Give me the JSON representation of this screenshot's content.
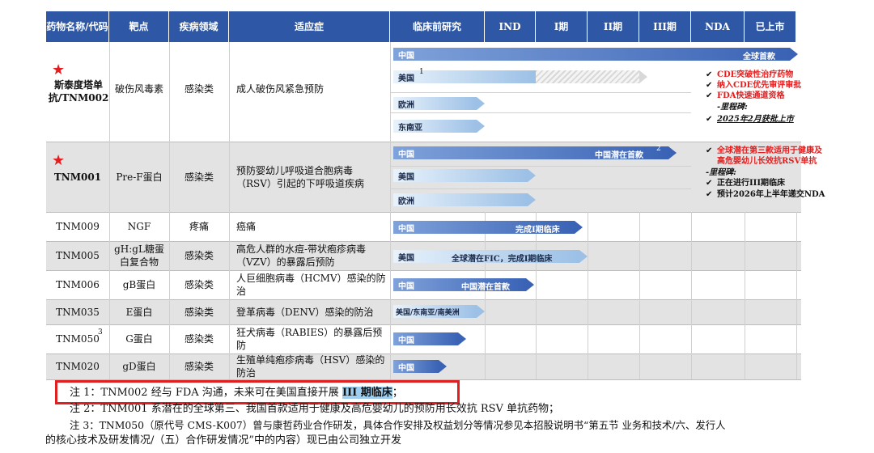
{
  "headers": {
    "drug": "药物名称/代码",
    "target": "靶点",
    "disease": "疾病领域",
    "indication": "适应症",
    "preclinical": "临床前研究",
    "ind": "IND",
    "phase1": "I期",
    "phase2": "II期",
    "phase3": "III期",
    "nda": "NDA",
    "marketed": "已上市"
  },
  "rows": [
    {
      "drug": "斯泰度塔单抗/TNM002",
      "star": "★",
      "target": "破伤风毒素",
      "disease": "感染类",
      "indication": "成人破伤风紧急预防",
      "bars": [
        {
          "region": "中国",
          "label": "全球首款"
        },
        {
          "region": "美国",
          "sup": "1"
        },
        {
          "region": "欧洲"
        },
        {
          "region": "东南亚"
        }
      ],
      "notes": [
        {
          "check": "✔",
          "text": "CDE突破性治疗药物",
          "style": "red"
        },
        {
          "check": "✔",
          "text": "纳入CDE优先审评审批",
          "style": "red"
        },
        {
          "check": "✔",
          "text": "FDA快速通道资格",
          "style": "red"
        },
        {
          "check": "",
          "text": "-里程碑:",
          "style": "italic"
        },
        {
          "check": "✔",
          "text": "2025年2月获批上市",
          "style": "underline"
        }
      ]
    },
    {
      "drug": "TNM001",
      "star": "★",
      "target": "Pre-F蛋白",
      "disease": "感染类",
      "indication": "预防婴幼儿呼吸道合胞病毒（RSV）引起的下呼吸道疾病",
      "bars": [
        {
          "region": "中国",
          "label": "中国潜在首款",
          "sup": "2"
        },
        {
          "region": "美国"
        },
        {
          "region": "欧洲"
        }
      ],
      "notes": [
        {
          "check": "✔",
          "text": "全球潜在第三款适用于健康及",
          "style": "red"
        },
        {
          "check": "",
          "text": "高危婴幼儿长效抗RSV单抗",
          "style": "red"
        },
        {
          "check": "",
          "text": "-里程碑:",
          "style": "italic"
        },
        {
          "check": "✔",
          "text": "正在进行III期临床",
          "style": "bold"
        },
        {
          "check": "✔",
          "text": "预计2026年上半年递交NDA",
          "style": "bold"
        }
      ]
    },
    {
      "drug": "TNM009",
      "target": "NGF",
      "disease": "疼痛",
      "indication": "癌痛",
      "bars": [
        {
          "region": "中国",
          "label": "完成I期临床"
        }
      ]
    },
    {
      "drug": "TNM005",
      "target": "gH:gL糖蛋白复合物",
      "disease": "感染类",
      "indication": "高危人群的水痘-带状疱疹病毒（VZV）的暴露后预防",
      "bars": [
        {
          "region": "美国",
          "label": "全球潜在FIC，完成I期临床"
        }
      ]
    },
    {
      "drug": "TNM006",
      "target": "gB蛋白",
      "disease": "感染类",
      "indication": "人巨细胞病毒（HCMV）感染的防治",
      "bars": [
        {
          "region": "中国",
          "label": "中国潜在首款"
        }
      ]
    },
    {
      "drug": "TNM035",
      "target": "E蛋白",
      "disease": "感染类",
      "indication": "登革病毒（DENV）感染的防治",
      "bars": [
        {
          "region": "美国/东南亚/南美洲"
        }
      ]
    },
    {
      "drug": "TNM050",
      "sup": "3",
      "target": "G蛋白",
      "disease": "感染类",
      "indication": "狂犬病毒（RABIES）的暴露后预防",
      "bars": [
        {
          "region": "中国"
        }
      ]
    },
    {
      "drug": "TNM020",
      "target": "gD蛋白",
      "disease": "感染类",
      "indication": "生殖单纯疱疹病毒（HSV）感染的防治",
      "bars": [
        {
          "region": "中国"
        }
      ]
    }
  ],
  "footnotes": {
    "note1_prefix": "注 1：TNM002 经与 FDA 沟通，未来可在美国直接开展 ",
    "note1_highlight": "III 期临床",
    "note1_suffix": "；",
    "note2": "注 2：TNM001 系潜在的全球第三、我国首款适用于健康及高危婴幼儿的预防用长效抗 RSV 单抗药物；",
    "note3_line1": "注 3：TNM050（原代号 CMS-K007）曾与康哲药业合作研发，具体合作安排及权益划分等情况参见本招股说明书“第五节  业务和技术/六、发行人",
    "note3_line2": "的核心技术及研发情况/（五）合作研发情况”中的内容）现已由公司独立开发"
  },
  "colors": {
    "header": "#2e58a6",
    "bar_dark": "#3b63b5",
    "bar_light": "#9cc0e6",
    "red": "#e41e1e",
    "highlight_border": "#e02020",
    "grey_row": "#e3e3e3"
  }
}
